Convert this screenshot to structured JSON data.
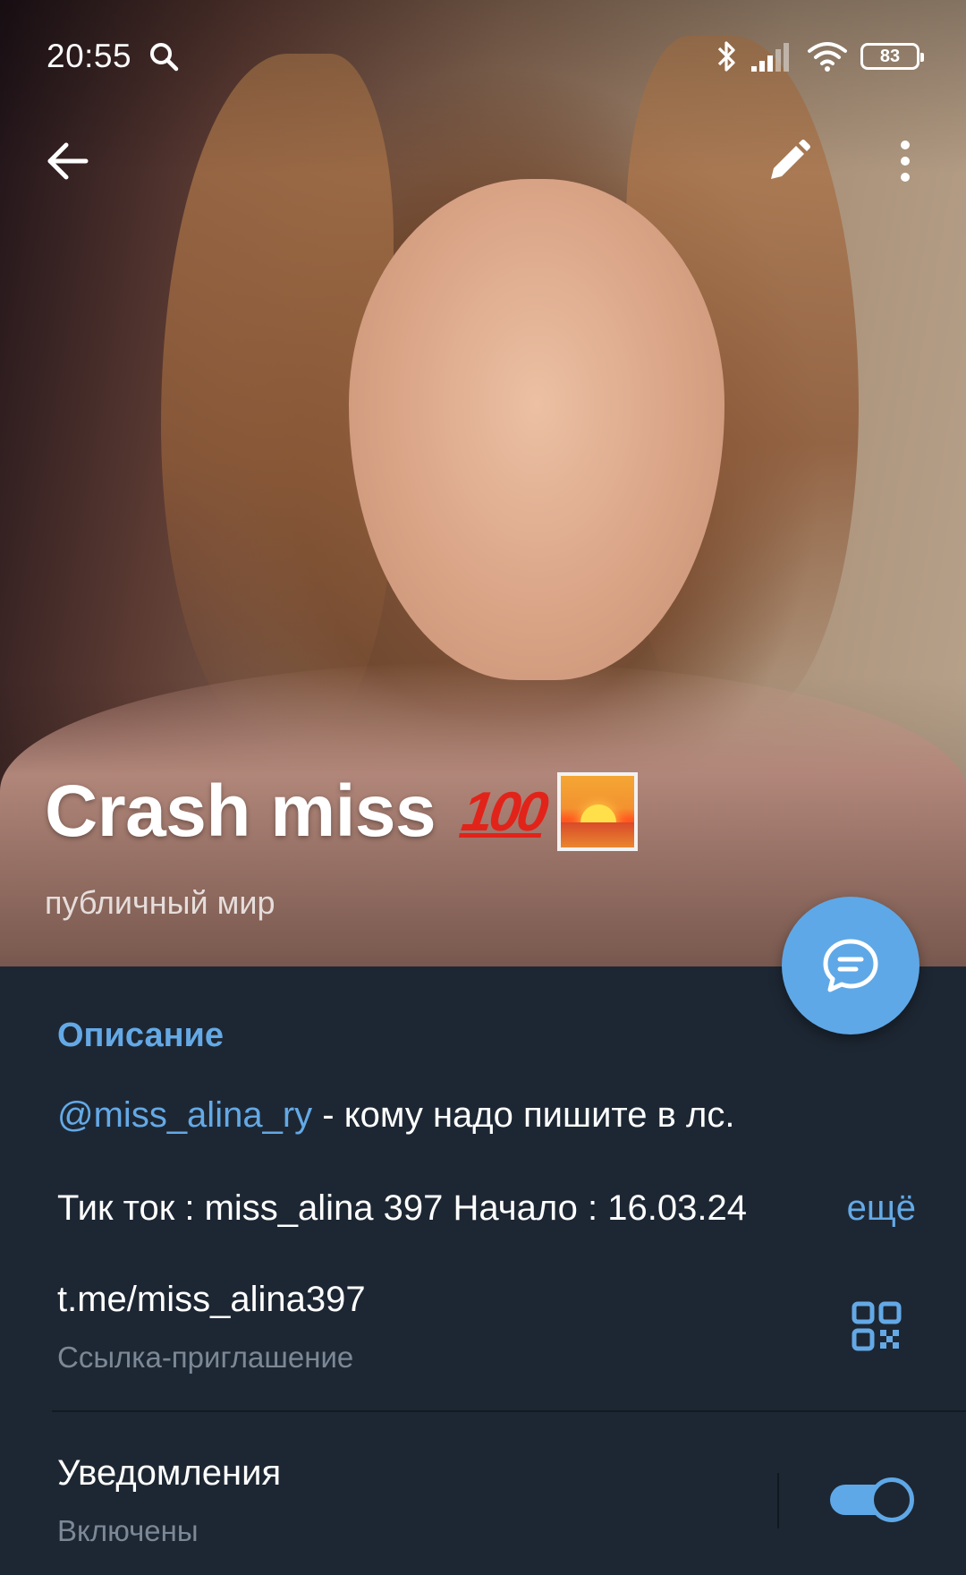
{
  "status_bar": {
    "time": "20:55",
    "battery": "83",
    "icons": [
      "search-icon",
      "bluetooth-icon",
      "signal-icon",
      "wifi-icon",
      "battery-icon"
    ]
  },
  "toolbar": {
    "back_icon": "arrow-left-icon",
    "edit_icon": "pencil-icon",
    "more_icon": "more-vertical-icon"
  },
  "profile": {
    "title": "Crash miss",
    "emoji_text": "100",
    "emoji_icons": [
      "hundred-points-emoji",
      "sunrise-emoji"
    ],
    "subtitle": "публичный мир"
  },
  "description": {
    "section_title": "Описание",
    "mention": "@miss_alina_ry",
    "line1_rest": " - кому надо пишите в лс.",
    "line2": "Тик ток : miss_alina 397  Начало : 16.03.24",
    "more_label": "ещё"
  },
  "invite_link": {
    "value": "t.me/miss_alina397",
    "label": "Ссылка-приглашение",
    "icon": "qr-code-icon"
  },
  "notifications": {
    "title": "Уведомления",
    "state": "Включены",
    "enabled": true
  },
  "colors": {
    "accent": "#64a9e6",
    "fab": "#5fa8e7",
    "panel_bg": "#1d2733",
    "secondary_text": "#7c8895"
  }
}
